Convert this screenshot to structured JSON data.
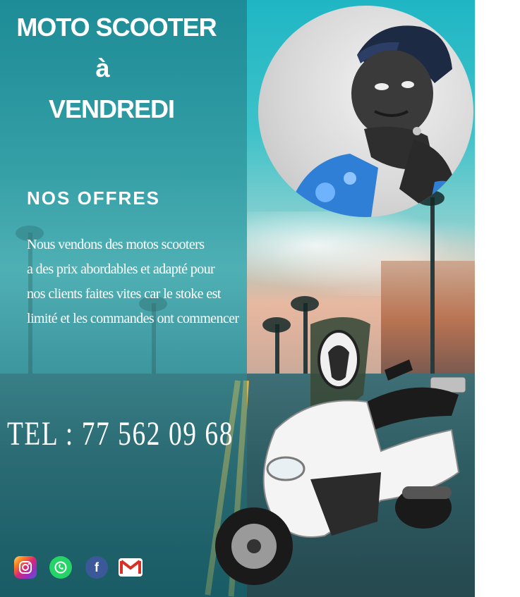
{
  "headline": {
    "line1": "MOTO SCOOTER",
    "line2": "à",
    "line3": "VENDREDI"
  },
  "offers": {
    "title": "NOS OFFRES",
    "lines": [
      "Nous vendons des motos scooters",
      "a des prix abordables et adapté pour",
      "nos clients faites vites car le stoke est",
      "limité et les commandes ont commencer"
    ]
  },
  "contact": {
    "phone": "TEL : 77 562 09 68"
  },
  "social_icons": [
    {
      "name": "instagram-icon",
      "color": "#e1306c"
    },
    {
      "name": "whatsapp-icon",
      "color": "#25d366"
    },
    {
      "name": "facebook-icon",
      "color": "#3b5998"
    },
    {
      "name": "gmail-icon",
      "color": "#d93025"
    }
  ],
  "colors": {
    "background": "#2f9aa3",
    "text": "#ffffff",
    "road_line": "#d9b34a",
    "scooter_body": "#f4f4f4"
  }
}
